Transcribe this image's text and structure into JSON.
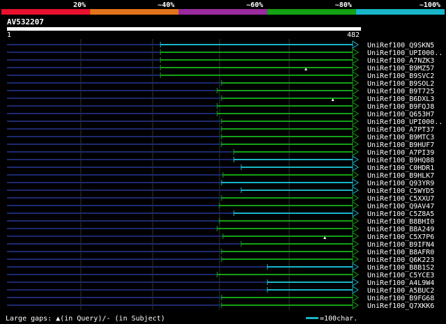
{
  "chart_data": {
    "type": "alignment-coverage",
    "query_id": "AV532207",
    "query_range": [
      "1",
      "482"
    ],
    "query_length": 482,
    "identity_legend": [
      {
        "label": "20%",
        "color": "#e8102e"
      },
      {
        "label": "~40%",
        "color": "#e2731c"
      },
      {
        "label": "~60%",
        "color": "#9a2aa0"
      },
      {
        "label": "~80%",
        "color": "#13a215"
      },
      {
        "label": "~100%",
        "color": "#18b6c8"
      }
    ],
    "footer_left": "Large gaps: ▲(in Query)/- (in Subject)",
    "footer_right": "=100char.",
    "scale_chars": 100,
    "hits": [
      {
        "name": "UniRef100_Q9SKN5",
        "start": 212,
        "end": 482,
        "color": "#18b6c8",
        "marker": null
      },
      {
        "name": "UniRef100_UPI000..",
        "start": 212,
        "end": 482,
        "color": "#13a215",
        "marker": null
      },
      {
        "name": "UniRef100_A7NZK3",
        "start": 212,
        "end": 482,
        "color": "#13a215",
        "marker": null
      },
      {
        "name": "UniRef100_B9MZ57",
        "start": 212,
        "end": 482,
        "color": "#13a215",
        "marker": 412
      },
      {
        "name": "UniRef100_B9SVC2",
        "start": 212,
        "end": 482,
        "color": "#13a215",
        "marker": null
      },
      {
        "name": "UniRef100_B9SOL2",
        "start": 296,
        "end": 482,
        "color": "#13a215",
        "marker": null
      },
      {
        "name": "UniRef100_B9T725",
        "start": 290,
        "end": 482,
        "color": "#13a215",
        "marker": null
      },
      {
        "name": "UniRef100_B6DXL3",
        "start": 296,
        "end": 482,
        "color": "#13a215",
        "marker": 449
      },
      {
        "name": "UniRef100_B9FQJ8",
        "start": 290,
        "end": 482,
        "color": "#13a215",
        "marker": null
      },
      {
        "name": "UniRef100_Q653H7",
        "start": 290,
        "end": 482,
        "color": "#13a215",
        "marker": null
      },
      {
        "name": "UniRef100_UPI000..",
        "start": 296,
        "end": 482,
        "color": "#13a215",
        "marker": null
      },
      {
        "name": "UniRef100_A7PT37",
        "start": 296,
        "end": 482,
        "color": "#13a215",
        "marker": null
      },
      {
        "name": "UniRef100_B9MTC3",
        "start": 296,
        "end": 482,
        "color": "#13a215",
        "marker": null
      },
      {
        "name": "UniRef100_B9HUF7",
        "start": 296,
        "end": 482,
        "color": "#13a215",
        "marker": null
      },
      {
        "name": "UniRef100_A7PI39",
        "start": 313,
        "end": 482,
        "color": "#13a215",
        "marker": null
      },
      {
        "name": "UniRef100_B9HQ88",
        "start": 313,
        "end": 482,
        "color": "#18b6c8",
        "marker": null
      },
      {
        "name": "UniRef100_C0HDR1",
        "start": 323,
        "end": 482,
        "color": "#18b6c8",
        "marker": null
      },
      {
        "name": "UniRef100_B9HLK7",
        "start": 298,
        "end": 482,
        "color": "#13a215",
        "marker": null
      },
      {
        "name": "UniRef100_Q93YR9",
        "start": 296,
        "end": 482,
        "color": "#18b6c8",
        "marker": null
      },
      {
        "name": "UniRef100_C5WYD5",
        "start": 323,
        "end": 482,
        "color": "#18b6c8",
        "marker": null
      },
      {
        "name": "UniRef100_C5XXU7",
        "start": 296,
        "end": 482,
        "color": "#13a215",
        "marker": null
      },
      {
        "name": "UniRef100_Q9AV47",
        "start": 293,
        "end": 482,
        "color": "#13a215",
        "marker": null
      },
      {
        "name": "UniRef100_C5Z8A5",
        "start": 313,
        "end": 482,
        "color": "#18b6c8",
        "marker": null
      },
      {
        "name": "UniRef100_B8BHI0",
        "start": 293,
        "end": 482,
        "color": "#13a215",
        "marker": null
      },
      {
        "name": "UniRef100_B8A249",
        "start": 290,
        "end": 482,
        "color": "#13a215",
        "marker": null
      },
      {
        "name": "UniRef100_C5X7P6",
        "start": 298,
        "end": 482,
        "color": "#13a215",
        "marker": 438
      },
      {
        "name": "UniRef100_B9IFN4",
        "start": 323,
        "end": 482,
        "color": "#13a215",
        "marker": null
      },
      {
        "name": "UniRef100_B8AFR0",
        "start": 296,
        "end": 482,
        "color": "#13a215",
        "marker": null
      },
      {
        "name": "UniRef100_Q6K223",
        "start": 296,
        "end": 482,
        "color": "#13a215",
        "marker": null
      },
      {
        "name": "UniRef100_B8B1S2",
        "start": 359,
        "end": 482,
        "color": "#18b6c8",
        "marker": null
      },
      {
        "name": "UniRef100_C5YCE3",
        "start": 290,
        "end": 482,
        "color": "#13a215",
        "marker": null
      },
      {
        "name": "UniRef100_A4L9W4",
        "start": 359,
        "end": 482,
        "color": "#18b6c8",
        "marker": null
      },
      {
        "name": "UniRef100_A5BUC2",
        "start": 359,
        "end": 482,
        "color": "#18b6c8",
        "marker": null
      },
      {
        "name": "UniRef100_B9FG68",
        "start": 296,
        "end": 482,
        "color": "#13a215",
        "marker": null
      },
      {
        "name": "UniRef100_Q7XKK6",
        "start": 296,
        "end": 482,
        "color": "#13a215",
        "marker": null
      }
    ]
  }
}
